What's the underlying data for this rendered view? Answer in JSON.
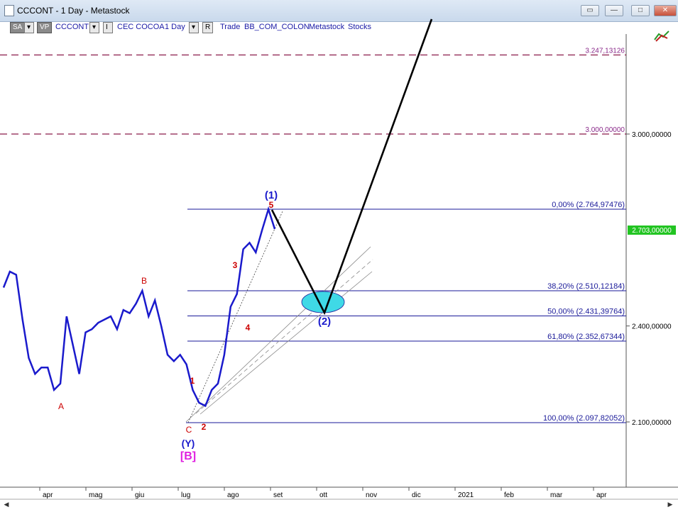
{
  "window": {
    "title": "CCCONT - 1 Day - Metastock",
    "restore_label": "▭",
    "minimize_label": "—",
    "maximize_label": "□",
    "close_label": "✕"
  },
  "toolbar": {
    "sa": "SA",
    "vp": "VP",
    "symbol": "CCCONT",
    "name": "CEC COCOA",
    "period": "1 Day",
    "r_label": "R",
    "trade": "Trade",
    "source": "BB_COM_COLON",
    "provider": "Metastock",
    "category": "Stocks"
  },
  "chart_data": {
    "type": "line",
    "series": [
      {
        "values": [
          2520,
          2570,
          2560,
          2420,
          2300,
          2250,
          2270,
          2270,
          2200,
          2220,
          2430,
          2340,
          2250,
          2380,
          2390,
          2410,
          2420,
          2430,
          2390,
          2450,
          2440,
          2470,
          2510,
          2430,
          2480,
          2400,
          2310,
          2290,
          2310,
          2280,
          2200,
          2160,
          2150,
          2200,
          2220,
          2310,
          2460,
          2500,
          2640,
          2660,
          2630,
          2700,
          2765,
          2703
        ]
      }
    ],
    "y_axis_labels": [
      {
        "value": 3000,
        "label": "3.000,00000"
      },
      {
        "value": 2400,
        "label": "2.400,00000"
      },
      {
        "value": 2100,
        "label": "2.100,00000"
      }
    ],
    "last_price": {
      "value": 2703,
      "label": "2.703,00000"
    },
    "x_axis_labels": [
      "apr",
      "mag",
      "giu",
      "lug",
      "ago",
      "set",
      "ott",
      "nov",
      "dic",
      "2021",
      "feb",
      "mar",
      "apr"
    ],
    "fib_levels": [
      {
        "value": 2764.97476,
        "label": "0,00% (2.764,97476)"
      },
      {
        "value": 2510.12184,
        "label": "38,20% (2.510,12184)"
      },
      {
        "value": 2431.39764,
        "label": "50,00% (2.431,39764)"
      },
      {
        "value": 2352.67344,
        "label": "61,80% (2.352,67344)"
      },
      {
        "value": 2097.82052,
        "label": "100,00% (2.097,82052)"
      }
    ],
    "targets": [
      {
        "value": 3247.13126,
        "label": "3.247,13126"
      },
      {
        "value": 3000.0,
        "label": "3.000,00000"
      }
    ],
    "wave_labels": {
      "a": "A",
      "b": "B",
      "c": "C",
      "y": "(Y)",
      "bb": "[B]",
      "w1": "1",
      "w2": "2",
      "w3": "3",
      "w4": "4",
      "w5": "5",
      "wave1": "(1)",
      "wave2": "(2)"
    },
    "colors": {
      "price": "#1a1acc",
      "fib": "#1a1a99",
      "target": "#8b1a4a",
      "projection": "#000000",
      "ellipse": "#3fd9e6",
      "labels": "#cc0000",
      "magenta": "#e020e0",
      "last_price_bg": "#22c422"
    }
  }
}
